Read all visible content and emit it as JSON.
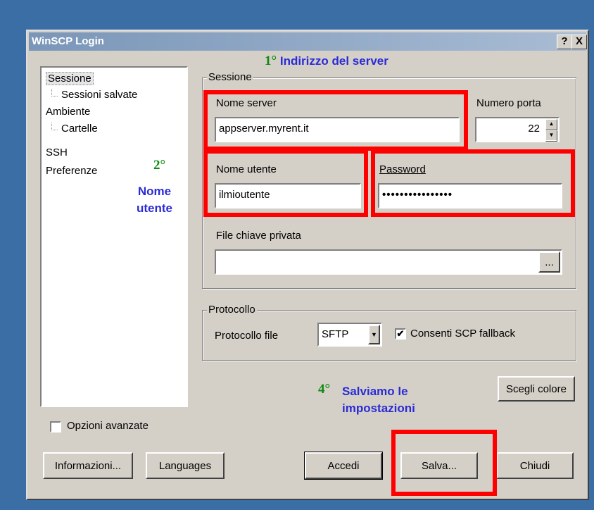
{
  "window": {
    "title": "WinSCP Login",
    "help_label": "?",
    "close_label": "X"
  },
  "tree": {
    "items": [
      {
        "label": "Sessione"
      },
      {
        "label": "Sessioni salvate"
      },
      {
        "label": "Ambiente"
      },
      {
        "label": "Cartelle"
      },
      {
        "label": "SSH"
      },
      {
        "label": "Preferenze"
      }
    ]
  },
  "session": {
    "legend": "Sessione",
    "server_label": "Nome server",
    "server_value": "appserver.myrent.it",
    "port_label": "Numero porta",
    "port_value": "22",
    "user_label": "Nome utente",
    "user_value": "ilmioutente",
    "password_label": "Password",
    "password_value": "••••••••••••••••",
    "keyfile_label": "File chiave privata",
    "keyfile_value": "",
    "browse_label": "..."
  },
  "protocol": {
    "legend": "Protocollo",
    "file_protocol_label": "Protocollo file",
    "selected": "SFTP",
    "fallback_label": "Consenti SCP fallback",
    "fallback_checked": true,
    "check_mark": "✔"
  },
  "buttons": {
    "color": "Scegli colore",
    "info": "Informazioni...",
    "languages": "Languages",
    "login": "Accedi",
    "save": "Salva...",
    "close": "Chiudi"
  },
  "advanced": {
    "label": "Opzioni avanzate",
    "checked": false
  },
  "annotations": {
    "a1_num": "1°",
    "a1_text": "Indirizzo del server",
    "a2_num": "2°",
    "a2_line1": "Nome",
    "a2_line2": "utente",
    "a4_num": "4°",
    "a4_line1": "Salviamo le",
    "a4_line2": "impostazioni"
  },
  "colors": {
    "desktop": "#3a6ea5",
    "highlight": "#ff0000",
    "annotation_text": "#2b2bd6",
    "annotation_number": "#0f8a0f"
  }
}
